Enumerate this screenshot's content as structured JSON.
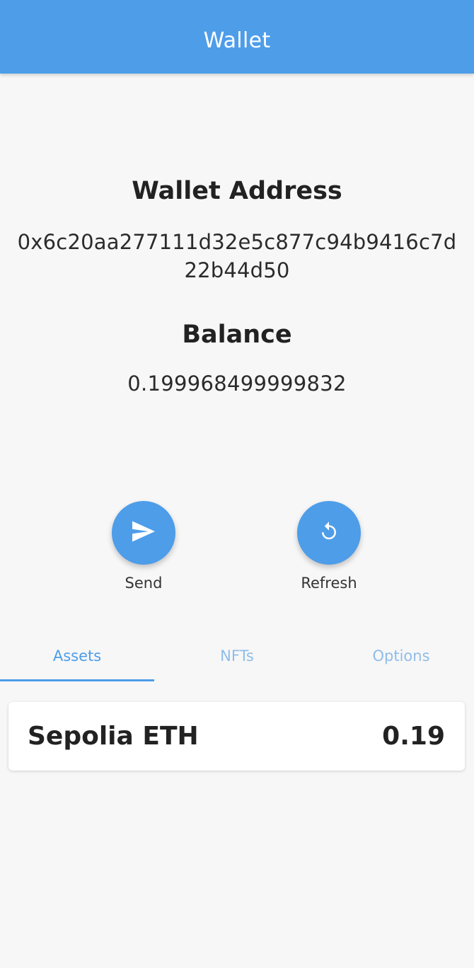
{
  "app_bar": {
    "title": "Wallet"
  },
  "wallet": {
    "address_heading": "Wallet Address",
    "address": "0x6c20aa277111d32e5c877c94b9416c7d22b44d50",
    "balance_heading": "Balance",
    "balance": "0.199968499999832"
  },
  "actions": [
    {
      "label": "Send",
      "icon": "send-icon"
    },
    {
      "label": "Refresh",
      "icon": "refresh-icon"
    }
  ],
  "tabs": [
    {
      "label": "Assets",
      "active": true
    },
    {
      "label": "NFTs",
      "active": false
    },
    {
      "label": "Options",
      "active": false
    }
  ],
  "assets": [
    {
      "name": "Sepolia ETH",
      "amount": "0.19"
    }
  ],
  "colors": {
    "primary": "#4d9de9",
    "tab_inactive": "#8fbde9",
    "background": "#f7f7f7"
  }
}
